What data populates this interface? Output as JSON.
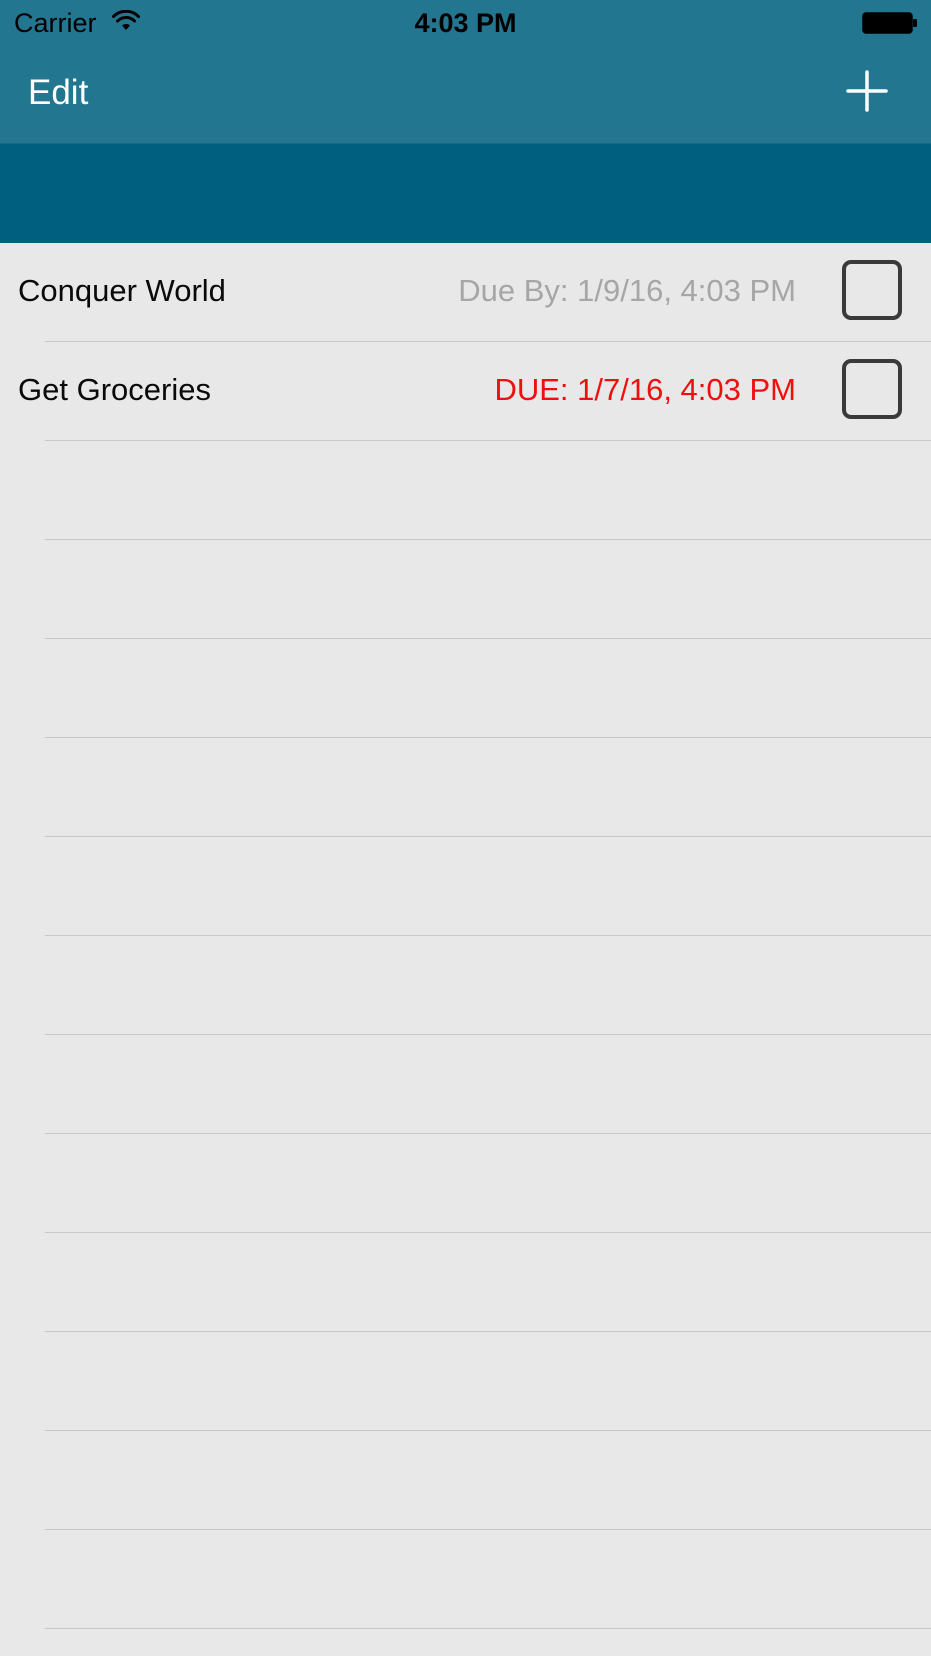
{
  "status_bar": {
    "carrier": "Carrier",
    "time": "4:03 PM",
    "wifi_icon": "wifi-icon",
    "battery_icon": "battery-icon"
  },
  "nav_bar": {
    "edit_label": "Edit",
    "add_icon": "plus-icon"
  },
  "colors": {
    "nav_background": "#237690",
    "banner_background": "#005f7f",
    "list_background": "#e8e8e8",
    "due_normal": "#a6a6a6",
    "due_overdue": "#f00f0f"
  },
  "tasks": [
    {
      "title": "Conquer World",
      "due": "Due By: 1/9/16, 4:03 PM",
      "overdue": false,
      "checked": false
    },
    {
      "title": "Get Groceries",
      "due": "DUE: 1/7/16, 4:03 PM",
      "overdue": true,
      "checked": false
    }
  ]
}
